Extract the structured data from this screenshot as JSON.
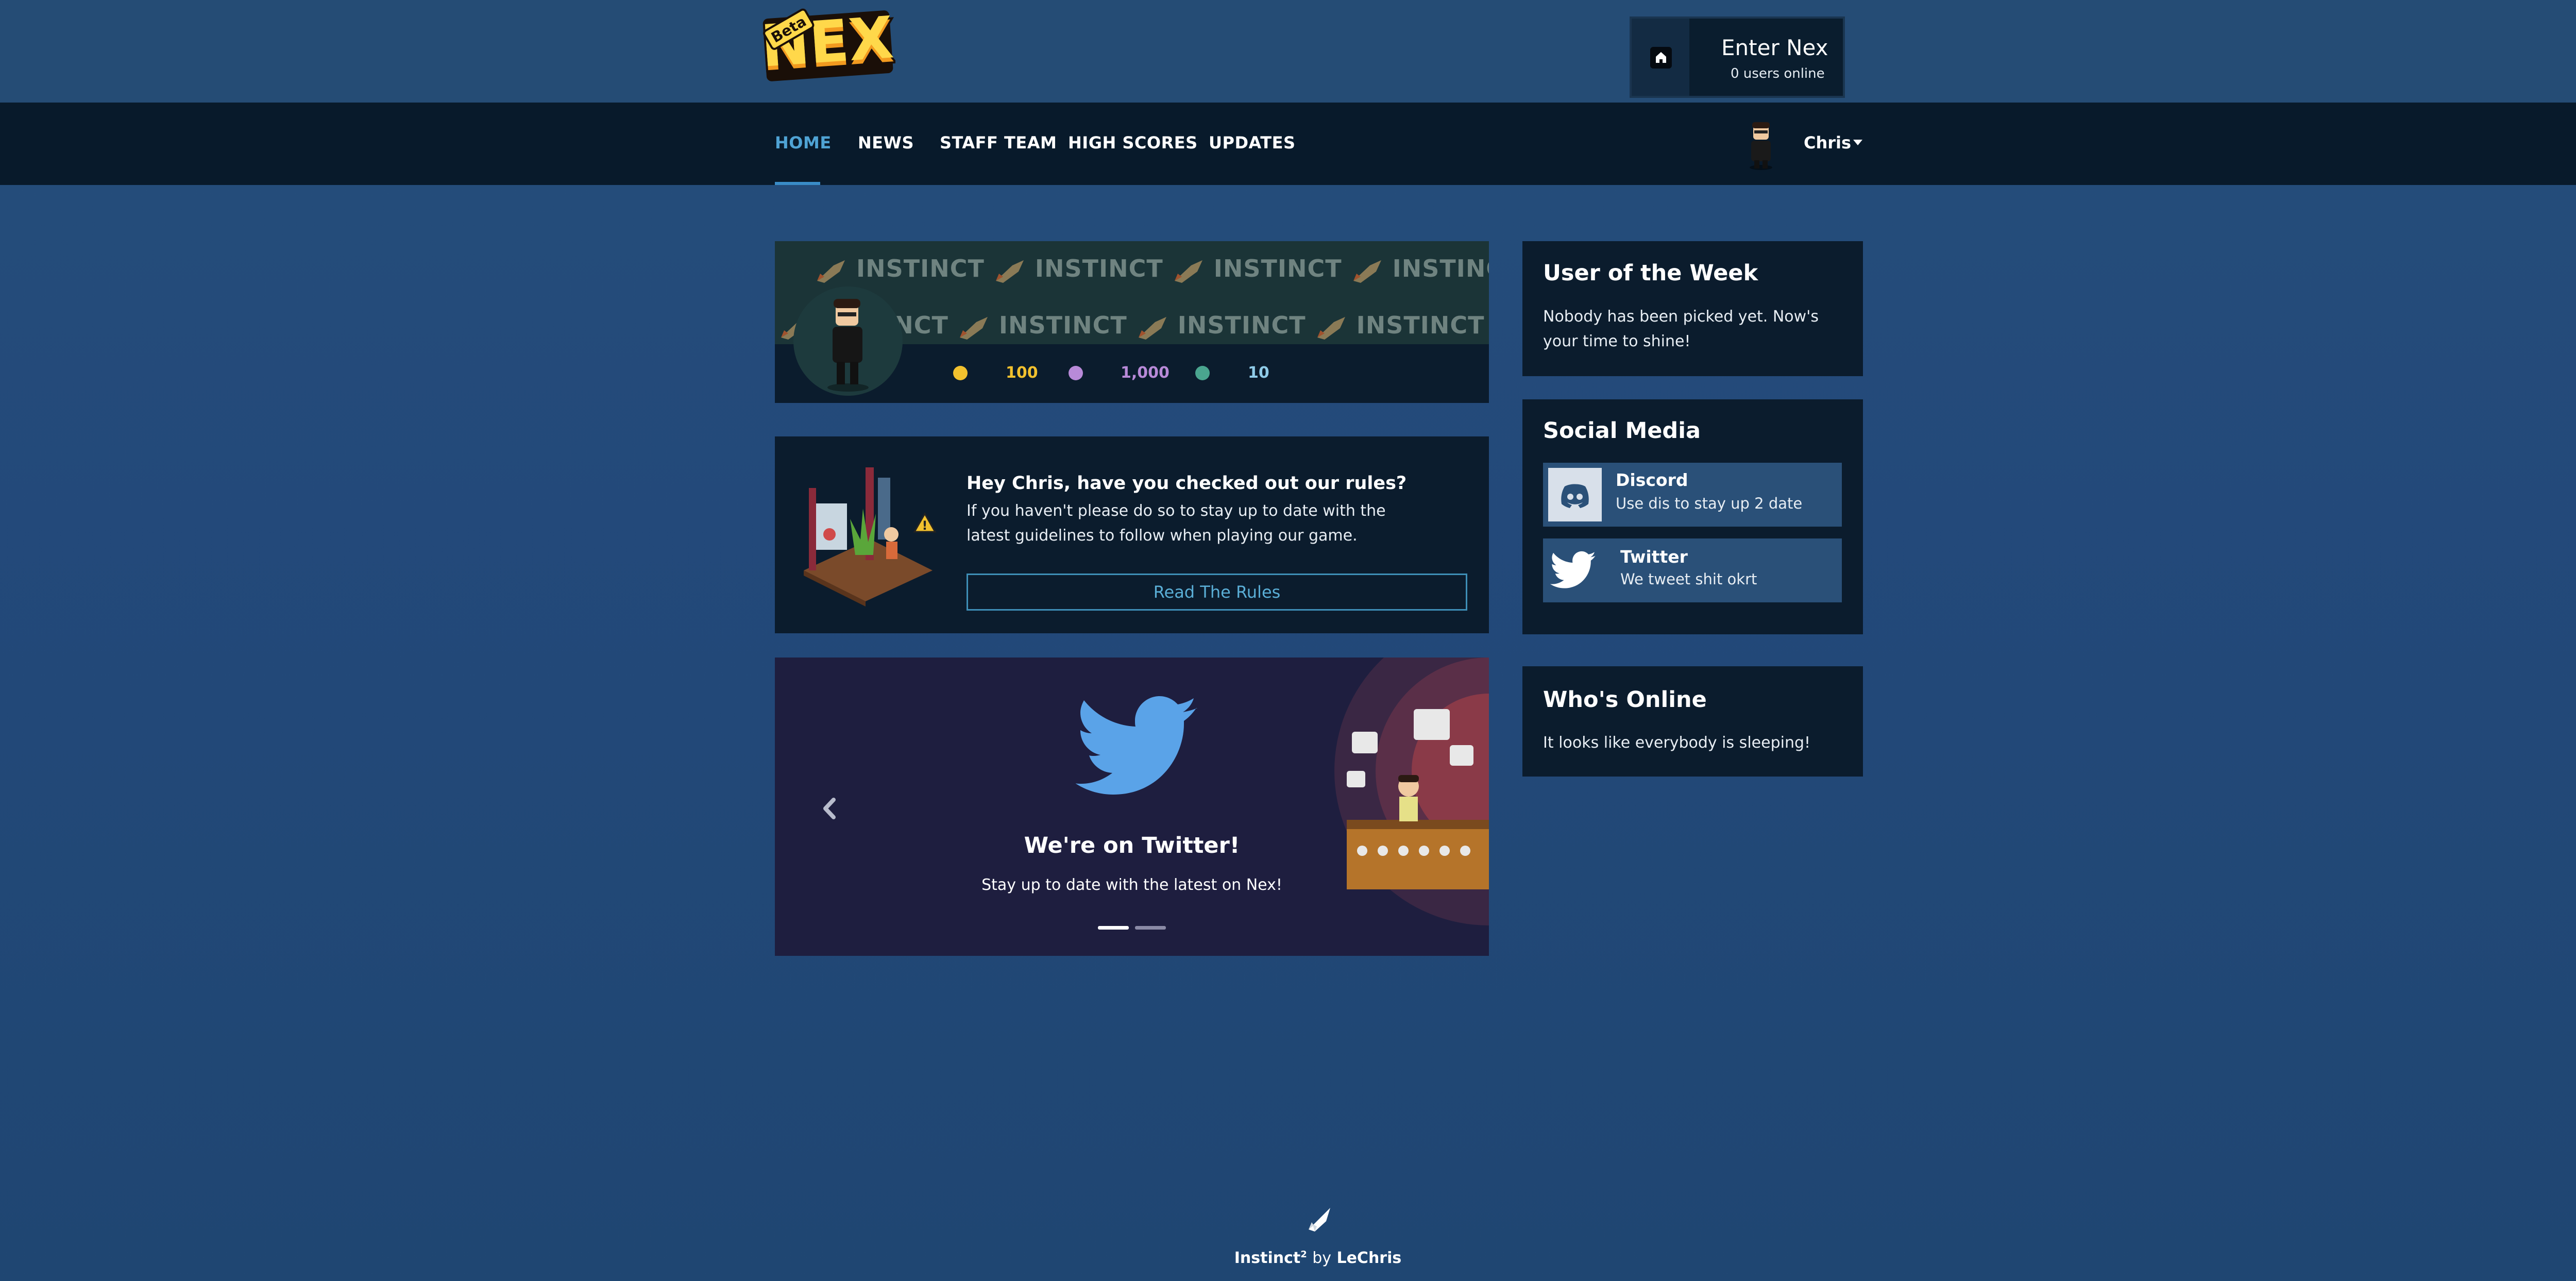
{
  "header": {
    "logo_badge": "Beta",
    "logo_text": "NEX",
    "enter_title": "Enter Nex",
    "users_online": "0 users online"
  },
  "nav": {
    "items": [
      "HOME",
      "NEWS",
      "STAFF TEAM",
      "HIGH SCORES",
      "UPDATES"
    ],
    "active": "HOME",
    "user_name": "Chris"
  },
  "profile": {
    "banner_word": "INSTINCT",
    "credits": "100",
    "duckets": "1,000",
    "diamonds": "10"
  },
  "rules": {
    "title": "Hey Chris, have you checked out our rules?",
    "text": "If you haven't please do so to stay up to date with the latest guidelines to follow when playing our game.",
    "button": "Read The Rules"
  },
  "carousel": {
    "title": "We're on Twitter!",
    "subtitle": "Stay up to date with the latest on Nex!",
    "slide_count": 2,
    "active_slide": 0
  },
  "sidebar": {
    "user_of_week": {
      "title": "User of the Week",
      "text": "Nobody has been picked yet. Now's your time to shine!"
    },
    "social": {
      "title": "Social Media",
      "items": [
        {
          "name": "Discord",
          "desc": "Use dis to stay up 2 date"
        },
        {
          "name": "Twitter",
          "desc": "We tweet shit okrt"
        }
      ]
    },
    "online": {
      "title": "Who's Online",
      "text": "It looks like everybody is sleeping!"
    }
  },
  "footer": {
    "brand": "Instinct",
    "brand_sup": "2",
    "by": "by",
    "author": "LeChris"
  },
  "colors": {
    "background": "#254e7a",
    "navbar": "#081a2b",
    "panel": "#0b1c2d",
    "accent": "#3a8cc7",
    "credits": "#f2c12e",
    "duckets": "#b88ad8",
    "diamonds": "#8fcbe8",
    "twitter": "#5aa3e8"
  },
  "icons": [
    "home-icon",
    "rocket-icon",
    "coin-icon",
    "ducket-icon",
    "diamond-icon",
    "discord-icon",
    "twitter-icon",
    "chevron-left-icon",
    "caret-down-icon"
  ]
}
